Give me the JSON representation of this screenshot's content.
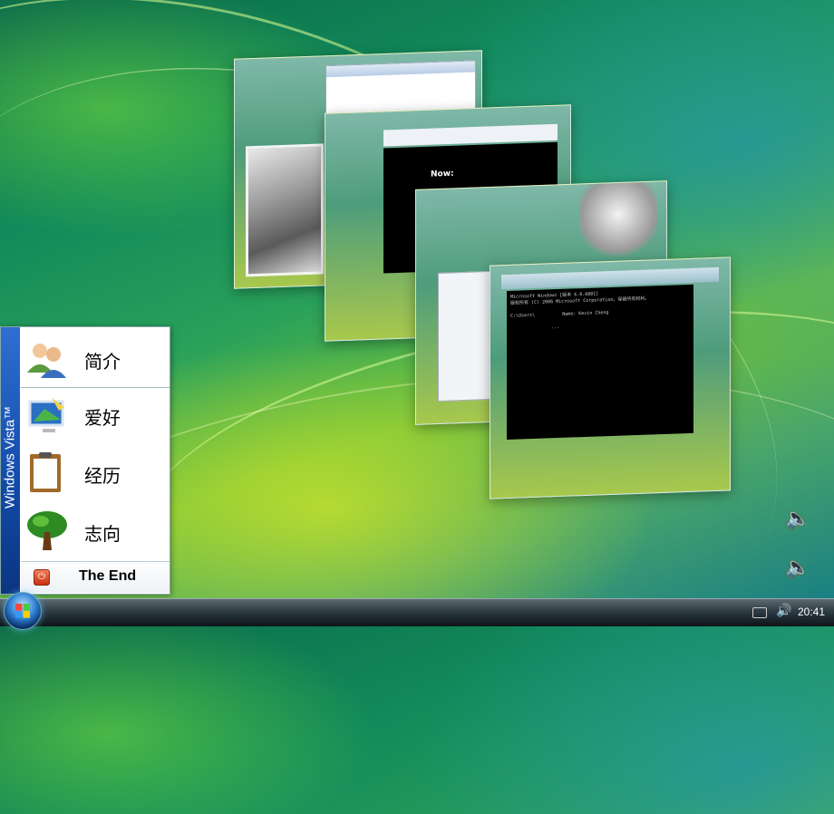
{
  "start_menu": {
    "brand": "Windows Vista™",
    "items": [
      {
        "label": "简介",
        "icon": "users-icon"
      },
      {
        "label": "爱好",
        "icon": "display-settings-icon"
      },
      {
        "label": "经历",
        "icon": "clipboard-icon"
      },
      {
        "label": "志向",
        "icon": "tree-icon"
      }
    ],
    "end_button": {
      "label": "The End",
      "icon": "power-icon"
    }
  },
  "flip3d": {
    "window2_text": "Now:",
    "console_lines": "Microsoft Windows [版本 6.0.6001]\n版权所有 (C) 2006 Microsoft Corporation。保留所有权利。\n\nC:\\Users\\          Name: Kevin Cheng\n\n               ..."
  },
  "desktop": {
    "sound_icons": [
      "speaker-icon",
      "speaker-icon"
    ]
  },
  "taskbar": {
    "clock": "20:41",
    "start_icon": "windows-orb-icon",
    "tray_icons": [
      "keyboard-icon",
      "volume-icon"
    ]
  }
}
